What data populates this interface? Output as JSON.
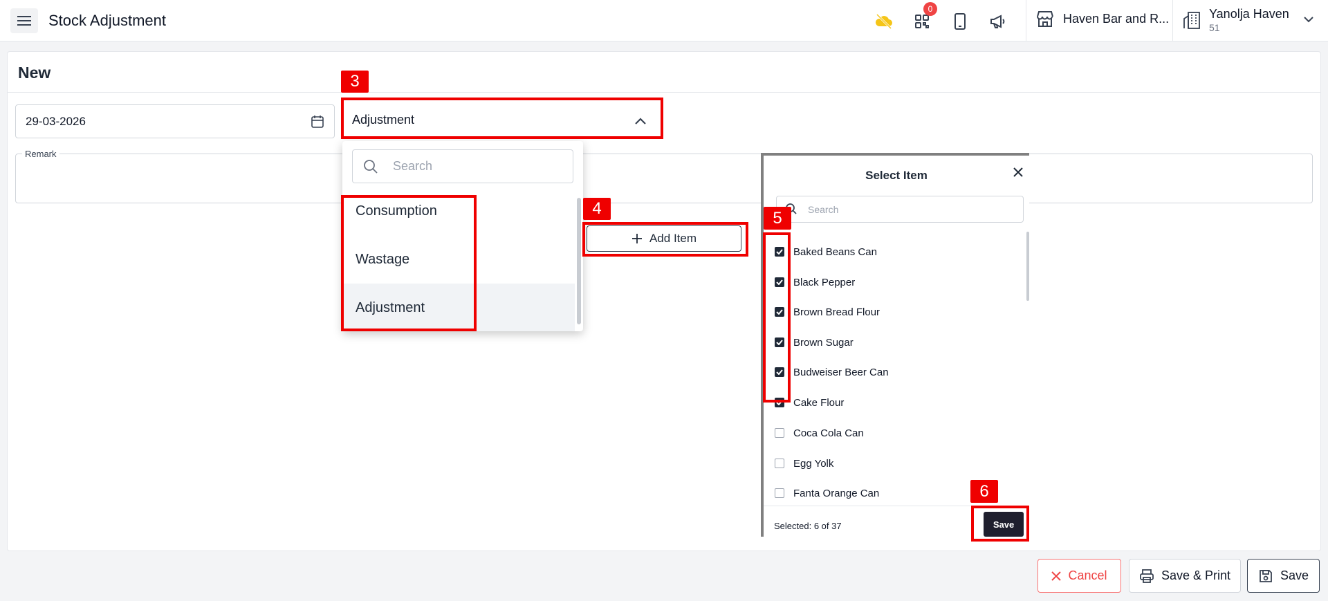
{
  "header": {
    "title": "Stock Adjustment",
    "qr_badge": "0",
    "outlet_name": "Haven Bar and R...",
    "user_name": "Yanolja Haven",
    "user_id": "51"
  },
  "form": {
    "heading": "New",
    "date_value": "29-03-2026",
    "type_value": "Adjustment",
    "remark_label": "Remark",
    "add_item_label": "Add Item"
  },
  "dropdown": {
    "search_placeholder": "Search",
    "options": [
      "Consumption",
      "Wastage",
      "Adjustment"
    ],
    "selected": "Adjustment"
  },
  "select_item": {
    "title": "Select Item",
    "search_placeholder": "Search",
    "items": [
      {
        "label": "Baked Beans Can",
        "checked": true
      },
      {
        "label": "Black Pepper",
        "checked": true
      },
      {
        "label": "Brown Bread Flour",
        "checked": true
      },
      {
        "label": "Brown Sugar",
        "checked": true
      },
      {
        "label": "Budweiser Beer Can",
        "checked": true
      },
      {
        "label": "Cake Flour",
        "checked": true
      },
      {
        "label": "Coca Cola Can",
        "checked": false
      },
      {
        "label": "Egg Yolk",
        "checked": false
      },
      {
        "label": "Fanta Orange Can",
        "checked": false
      }
    ],
    "selected_count": "Selected: 6 of 37",
    "save_label": "Save"
  },
  "footer": {
    "cancel_label": "Cancel",
    "save_print_label": "Save & Print",
    "save_label": "Save"
  },
  "annotations": [
    "3",
    "4",
    "5",
    "6"
  ],
  "colors": {
    "annotation_red": "#ef0000",
    "cloud_icon": "#f5c518",
    "dark_button": "#1f1f2e",
    "cancel_red": "#ef4444"
  }
}
